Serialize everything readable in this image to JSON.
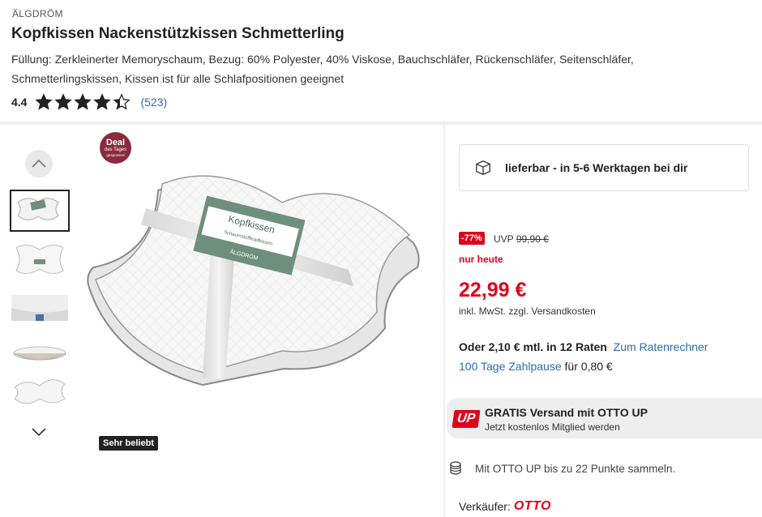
{
  "product": {
    "brand": "ÄLGDRÖM",
    "title": "Kopfkissen Nackenstützkissen Schmetterling",
    "description": "Füllung: Zerkleinerter Memoryschaum, Bezug: 60% Polyester, 40% Viskose, Bauchschläfer, Rückenschläfer, Seitenschläfer, Schmetterlingskissen, Kissen ist für alle Schlafpositionen geeignet",
    "rating_value": "4.4",
    "rating_stars": 4.4,
    "rating_count": "(523)"
  },
  "gallery": {
    "deal_badge": {
      "line1": "Deal",
      "line2": "des Tages",
      "line3": "gesponsert"
    },
    "popular_badge": "Sehr beliebt",
    "package_label": {
      "title": "Kopfkissen",
      "subtitle": "Schaumstoffkopfkissen",
      "brand": "ÄLGDRÖM"
    },
    "up_icon": "chevron-up-icon",
    "down_icon": "chevron-down-icon"
  },
  "buybox": {
    "delivery": "lieferbar - in 5-6 Werktagen bei dir",
    "discount": "-77%",
    "uvp_label": "UVP",
    "uvp_price": "99,90 €",
    "only_today": "nur heute",
    "price": "22,99 €",
    "tax_text": "inkl. MwSt. zzgl.",
    "shipping_link": "Versandkosten",
    "installment_text": "Oder 2,10 € mtl. in 12 Raten",
    "installment_link": "Zum Ratenrechner",
    "pause_link": "100 Tage Zahlpause",
    "pause_text": "für 0,80 €",
    "otto_up": {
      "logo": "UP",
      "title": "GRATIS Versand mit OTTO UP",
      "subtitle": "Jetzt kostenlos Mitglied werden"
    },
    "points_text": "Mit OTTO UP bis zu 22 Punkte sammeln.",
    "seller_label": "Verkäufer:",
    "seller_name": "OTTO"
  },
  "colors": {
    "accent_red": "#e0001b",
    "link_blue": "#2b6cb0",
    "deal_badge": "#8a2a3e"
  }
}
